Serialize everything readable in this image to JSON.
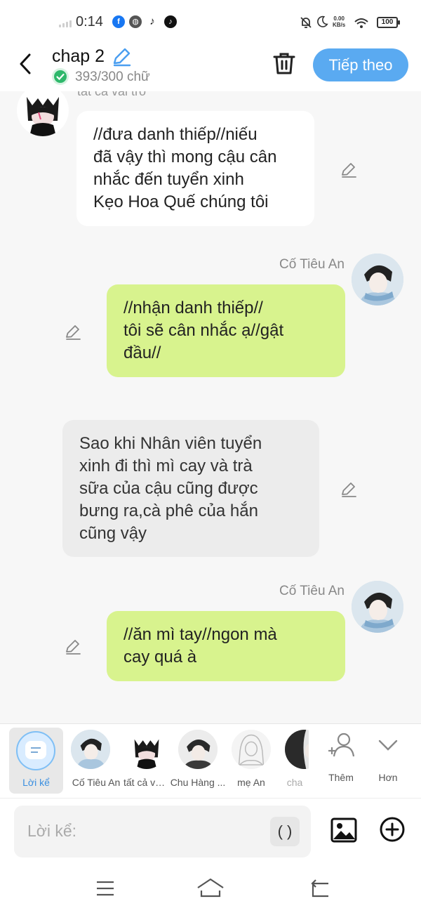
{
  "status_bar": {
    "time": "0:14",
    "net_speed_value": "0.00",
    "net_speed_unit": "KB/s",
    "battery": "100"
  },
  "header": {
    "title": "chap 2",
    "word_count": "393/300 chữ",
    "next_label": "Tiếp theo"
  },
  "chat": {
    "top_sender_cut": "tất cả vai trò",
    "messages": [
      {
        "sender": "",
        "text": "//đưa danh thiếp//niếu\nđã vậy thì mong cậu cân\nnhắc đến tuyển xinh\nKẹo Hoa Quế chúng tôi"
      },
      {
        "sender": "Cố Tiêu An",
        "text": "//nhận danh thiếp//\ntôi sẽ cân nhắc ạ//gật\nđầu//"
      },
      {
        "sender": "",
        "text": "Sao khi Nhân viên tuyển\nxinh đi thì mì cay và trà\nsữa của cậu cũng được\nbưng ra,cà phê của hắn\ncũng vậy"
      },
      {
        "sender": "Cố Tiêu An",
        "text": "//ăn mì tay//ngon mà\ncay quá à"
      }
    ]
  },
  "characters": {
    "narrator_label": "Lời kể",
    "items": [
      {
        "label": "Cố Tiêu An"
      },
      {
        "label": "tất cả vai t..."
      },
      {
        "label": "Chu Hàng ..."
      },
      {
        "label": "mẹ An"
      },
      {
        "label": "cha"
      }
    ],
    "add_label": "Thêm",
    "more_label": "Hơn"
  },
  "composer": {
    "placeholder": "Lời kể:",
    "paren_label": "( )"
  }
}
